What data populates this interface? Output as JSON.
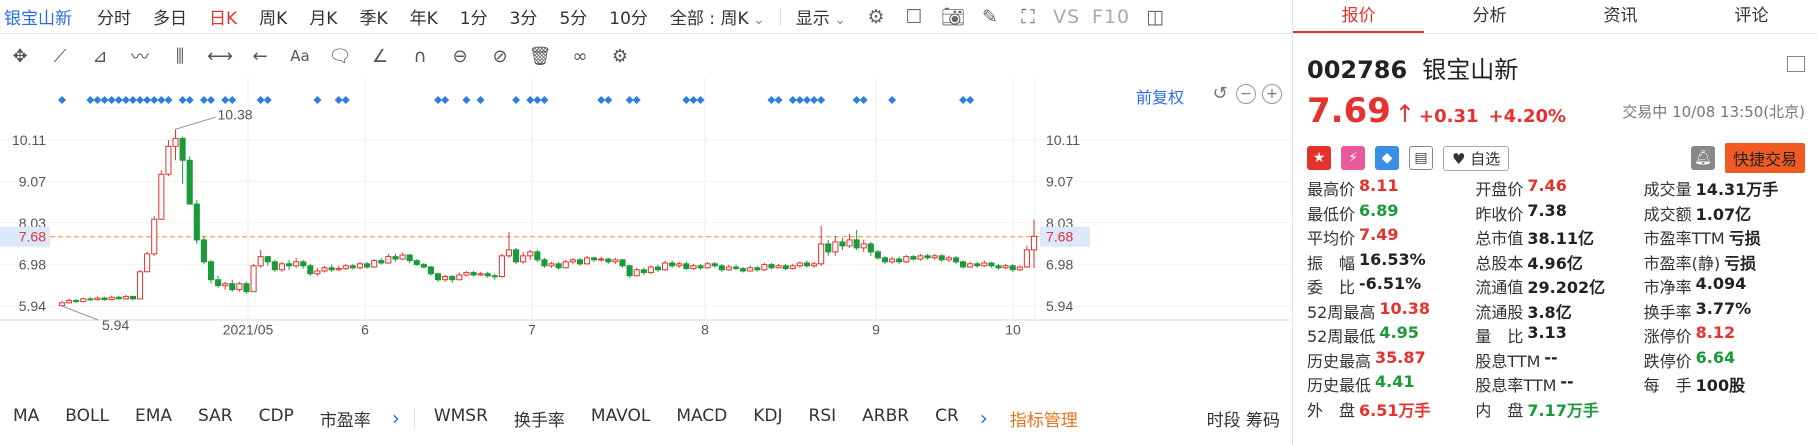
{
  "period_bar": {
    "stock_name": "银宝山新",
    "periods": [
      "分时",
      "多日",
      "日K",
      "周K",
      "月K",
      "季K",
      "年K",
      "1分",
      "3分",
      "5分",
      "10分"
    ],
    "active_period": "日K",
    "range_select": "全部 : 周K",
    "display_label": "显示",
    "vs_label": "VS",
    "f10_label": "F10"
  },
  "chart_header": {
    "fuquan_label": "前复权"
  },
  "chart_data": {
    "type": "candlestick",
    "y_ticks": [
      10.11,
      9.07,
      8.03,
      6.98,
      5.94
    ],
    "y_tick_labels": [
      "10.11",
      "9.07",
      "8.03",
      "6.98",
      "5.94"
    ],
    "x_labels": [
      "2021/05",
      "6",
      "7",
      "8",
      "9",
      "10"
    ],
    "ylim": [
      5.3,
      10.7
    ],
    "current_price_line": 7.68,
    "current_price_label": "7.68",
    "high_marker": "10.38",
    "low_marker": "5.94",
    "colors": {
      "up": "#e6322e",
      "down": "#1b9a3a",
      "signal": "#2e7de1",
      "price_line": "#f08a2e"
    },
    "candles": [
      [
        5.95,
        6.02,
        6.06,
        5.94
      ],
      [
        6.02,
        6.08,
        6.12,
        6.0
      ],
      [
        6.08,
        6.05,
        6.12,
        6.02
      ],
      [
        6.05,
        6.12,
        6.15,
        6.03
      ],
      [
        6.12,
        6.1,
        6.16,
        6.07
      ],
      [
        6.1,
        6.14,
        6.18,
        6.08
      ],
      [
        6.14,
        6.1,
        6.17,
        6.07
      ],
      [
        6.1,
        6.16,
        6.2,
        6.08
      ],
      [
        6.16,
        6.12,
        6.2,
        6.1
      ],
      [
        6.12,
        6.18,
        6.22,
        6.1
      ],
      [
        6.18,
        6.12,
        6.2,
        6.08
      ],
      [
        6.12,
        6.8,
        6.85,
        6.12
      ],
      [
        6.8,
        7.25,
        7.3,
        6.8
      ],
      [
        7.25,
        8.12,
        8.2,
        7.2
      ],
      [
        8.12,
        9.25,
        9.35,
        8.1
      ],
      [
        9.25,
        9.95,
        10.11,
        9.2
      ],
      [
        9.95,
        10.15,
        10.38,
        9.6
      ],
      [
        10.15,
        9.6,
        10.2,
        9.0
      ],
      [
        9.6,
        8.5,
        9.7,
        8.5
      ],
      [
        8.5,
        7.6,
        8.6,
        7.5
      ],
      [
        7.6,
        7.05,
        7.7,
        7.0
      ],
      [
        7.05,
        6.6,
        7.1,
        6.5
      ],
      [
        6.6,
        6.45,
        6.7,
        6.4
      ],
      [
        6.45,
        6.5,
        6.55,
        6.35
      ],
      [
        6.5,
        6.35,
        6.6,
        6.3
      ],
      [
        6.35,
        6.5,
        6.55,
        6.3
      ],
      [
        6.5,
        6.3,
        6.55,
        6.25
      ],
      [
        6.3,
        6.95,
        7.0,
        6.3
      ],
      [
        6.95,
        7.18,
        7.35,
        6.9
      ],
      [
        7.18,
        7.05,
        7.2,
        6.95
      ],
      [
        7.05,
        6.85,
        7.1,
        6.8
      ],
      [
        6.85,
        7.0,
        7.05,
        6.8
      ],
      [
        7.0,
        6.95,
        7.1,
        6.85
      ],
      [
        6.95,
        7.05,
        7.15,
        6.9
      ],
      [
        7.05,
        6.95,
        7.1,
        6.88
      ],
      [
        6.95,
        6.75,
        7.0,
        6.7
      ],
      [
        6.75,
        6.82,
        6.9,
        6.7
      ],
      [
        6.82,
        6.9,
        6.95,
        6.78
      ],
      [
        6.9,
        6.85,
        6.98,
        6.8
      ],
      [
        6.85,
        6.88,
        6.95,
        6.82
      ],
      [
        6.88,
        6.95,
        7.0,
        6.85
      ],
      [
        6.95,
        6.9,
        7.0,
        6.85
      ],
      [
        6.9,
        7.0,
        7.05,
        6.86
      ],
      [
        7.0,
        6.92,
        7.05,
        6.88
      ],
      [
        6.92,
        7.08,
        7.12,
        6.9
      ],
      [
        7.08,
        7.02,
        7.15,
        6.98
      ],
      [
        7.02,
        7.18,
        7.25,
        7.0
      ],
      [
        7.18,
        7.12,
        7.25,
        7.05
      ],
      [
        7.12,
        7.22,
        7.28,
        7.1
      ],
      [
        7.22,
        7.08,
        7.25,
        7.02
      ],
      [
        7.08,
        6.98,
        7.12,
        6.95
      ],
      [
        6.98,
        6.92,
        7.02,
        6.88
      ],
      [
        6.92,
        6.75,
        6.95,
        6.7
      ],
      [
        6.75,
        6.6,
        6.78,
        6.55
      ],
      [
        6.6,
        6.68,
        6.72,
        6.55
      ],
      [
        6.68,
        6.6,
        6.72,
        6.52
      ],
      [
        6.6,
        6.72,
        6.78,
        6.58
      ],
      [
        6.72,
        6.78,
        6.82,
        6.68
      ],
      [
        6.78,
        6.72,
        6.82,
        6.68
      ],
      [
        6.72,
        6.75,
        6.8,
        6.7
      ],
      [
        6.75,
        6.7,
        6.8,
        6.65
      ],
      [
        6.7,
        6.68,
        6.75,
        6.6
      ],
      [
        6.68,
        7.2,
        7.25,
        6.65
      ],
      [
        7.2,
        7.35,
        7.8,
        7.15
      ],
      [
        7.35,
        7.05,
        7.4,
        7.0
      ],
      [
        7.05,
        7.2,
        7.3,
        7.0
      ],
      [
        7.2,
        7.3,
        7.35,
        7.1
      ],
      [
        7.3,
        7.1,
        7.35,
        7.05
      ],
      [
        7.1,
        6.95,
        7.15,
        6.9
      ],
      [
        6.95,
        7.0,
        7.05,
        6.9
      ],
      [
        7.0,
        6.9,
        7.05,
        6.85
      ],
      [
        6.9,
        7.05,
        7.1,
        6.88
      ],
      [
        7.05,
        7.1,
        7.15,
        7.0
      ],
      [
        7.1,
        7.0,
        7.15,
        6.95
      ],
      [
        7.0,
        7.15,
        7.2,
        6.98
      ],
      [
        7.15,
        7.1,
        7.18,
        7.05
      ],
      [
        7.1,
        7.12,
        7.18,
        7.05
      ],
      [
        7.12,
        7.05,
        7.15,
        7.0
      ],
      [
        7.05,
        7.1,
        7.15,
        7.0
      ],
      [
        7.1,
        6.95,
        7.12,
        6.9
      ],
      [
        6.95,
        6.7,
        6.98,
        6.65
      ],
      [
        6.7,
        6.85,
        6.9,
        6.68
      ],
      [
        6.85,
        6.78,
        6.9,
        6.72
      ],
      [
        6.78,
        6.92,
        6.96,
        6.75
      ],
      [
        6.92,
        6.85,
        6.98,
        6.8
      ],
      [
        6.85,
        7.02,
        7.08,
        6.82
      ],
      [
        7.02,
        6.95,
        7.08,
        6.9
      ],
      [
        6.95,
        7.0,
        7.05,
        6.9
      ],
      [
        7.0,
        6.88,
        7.05,
        6.85
      ],
      [
        6.88,
        6.95,
        7.0,
        6.85
      ],
      [
        6.95,
        6.9,
        7.0,
        6.85
      ],
      [
        6.9,
        7.0,
        7.05,
        6.88
      ],
      [
        7.0,
        6.95,
        7.05,
        6.9
      ],
      [
        6.95,
        6.85,
        7.0,
        6.8
      ],
      [
        6.85,
        6.92,
        6.98,
        6.82
      ],
      [
        6.92,
        6.88,
        6.98,
        6.84
      ],
      [
        6.88,
        6.82,
        6.92,
        6.78
      ],
      [
        6.82,
        6.9,
        6.96,
        6.8
      ],
      [
        6.9,
        6.85,
        6.95,
        6.8
      ],
      [
        6.85,
        6.98,
        7.02,
        6.82
      ],
      [
        6.98,
        6.9,
        7.02,
        6.86
      ],
      [
        6.9,
        6.95,
        7.0,
        6.88
      ],
      [
        6.95,
        6.88,
        7.0,
        6.84
      ],
      [
        6.88,
        6.95,
        7.0,
        6.85
      ],
      [
        6.95,
        7.02,
        7.06,
        6.9
      ],
      [
        7.02,
        6.95,
        7.08,
        6.9
      ],
      [
        6.95,
        7.0,
        7.05,
        6.9
      ],
      [
        7.0,
        7.5,
        7.95,
        6.95
      ],
      [
        7.5,
        7.3,
        7.6,
        7.2
      ],
      [
        7.3,
        7.55,
        7.7,
        7.2
      ],
      [
        7.55,
        7.45,
        7.65,
        7.35
      ],
      [
        7.45,
        7.6,
        7.75,
        7.4
      ],
      [
        7.6,
        7.4,
        7.85,
        7.35
      ],
      [
        7.4,
        7.5,
        7.6,
        7.3
      ],
      [
        7.5,
        7.3,
        7.55,
        7.2
      ],
      [
        7.3,
        7.15,
        7.35,
        7.1
      ],
      [
        7.15,
        7.05,
        7.2,
        7.0
      ],
      [
        7.05,
        7.12,
        7.18,
        7.0
      ],
      [
        7.12,
        7.05,
        7.18,
        7.0
      ],
      [
        7.05,
        7.18,
        7.22,
        7.02
      ],
      [
        7.18,
        7.12,
        7.22,
        7.08
      ],
      [
        7.12,
        7.2,
        7.25,
        7.08
      ],
      [
        7.2,
        7.15,
        7.25,
        7.1
      ],
      [
        7.15,
        7.2,
        7.25,
        7.1
      ],
      [
        7.2,
        7.1,
        7.25,
        7.05
      ],
      [
        7.1,
        7.15,
        7.2,
        7.05
      ],
      [
        7.15,
        7.05,
        7.2,
        7.0
      ],
      [
        7.05,
        6.92,
        7.08,
        6.88
      ],
      [
        6.92,
        7.0,
        7.05,
        6.9
      ],
      [
        7.0,
        6.95,
        7.05,
        6.9
      ],
      [
        6.95,
        7.02,
        7.08,
        6.92
      ],
      [
        7.02,
        6.95,
        7.05,
        6.9
      ],
      [
        6.95,
        6.9,
        7.0,
        6.85
      ],
      [
        6.9,
        6.95,
        7.0,
        6.86
      ],
      [
        6.95,
        6.85,
        7.0,
        6.8
      ],
      [
        6.85,
        6.92,
        6.96,
        6.82
      ],
      [
        6.92,
        7.35,
        7.45,
        6.9
      ],
      [
        7.35,
        7.69,
        8.11,
        6.89
      ]
    ],
    "signal_markers": [
      0,
      4,
      5,
      6,
      7,
      8,
      9,
      10,
      11,
      12,
      13,
      14,
      15,
      17,
      18,
      20,
      21,
      23,
      24,
      28,
      29,
      36,
      39,
      40,
      53,
      54,
      57,
      59,
      64,
      66,
      67,
      68,
      76,
      77,
      80,
      81,
      88,
      89,
      90,
      100,
      101,
      103,
      104,
      105,
      106,
      107,
      112,
      113,
      117,
      127,
      128
    ]
  },
  "indicator_bar": {
    "items_left": [
      "MA",
      "BOLL",
      "EMA",
      "SAR",
      "CDP",
      "市盈率"
    ],
    "items_right": [
      "WMSR",
      "换手率",
      "MAVOL",
      "MACD",
      "KDJ",
      "RSI",
      "ARBR",
      "CR"
    ],
    "manage_label": "指标管理",
    "right_label": "时段 筹码"
  },
  "right_panel": {
    "tabs": [
      "报价",
      "分析",
      "资讯",
      "评论"
    ],
    "active_tab": "报价",
    "code": "002786",
    "name": "银宝山新",
    "price": "7.69",
    "change": "+0.31",
    "change_pct": "+4.20%",
    "trade_time": "交易中 10/08 13:50(北京)",
    "zixuan_label": "自选",
    "trade_button": "快捷交易",
    "stats": [
      [
        {
          "label": "最高价",
          "value": "8.11",
          "color": "red"
        },
        {
          "label": "开盘价",
          "value": "7.46",
          "color": "red"
        },
        {
          "label": "成交量",
          "value": "14.31万手",
          "color": "dark"
        }
      ],
      [
        {
          "label": "最低价",
          "value": "6.89",
          "color": "green"
        },
        {
          "label": "昨收价",
          "value": "7.38",
          "color": "dark"
        },
        {
          "label": "成交额",
          "value": "1.07亿",
          "color": "dark"
        }
      ],
      [
        {
          "label": "平均价",
          "value": "7.49",
          "color": "red"
        },
        {
          "label": "总市值",
          "value": "38.11亿",
          "color": "dark"
        },
        {
          "label": "市盈率TTM",
          "value": "亏损",
          "color": "dark"
        }
      ],
      [
        {
          "label": "振　幅",
          "value": "16.53%",
          "color": "dark"
        },
        {
          "label": "总股本",
          "value": "4.96亿",
          "color": "dark"
        },
        {
          "label": "市盈率(静)",
          "value": "亏损",
          "color": "dark"
        }
      ],
      [
        {
          "label": "委　比",
          "value": "-6.51%",
          "color": "dark"
        },
        {
          "label": "流通值",
          "value": "29.202亿",
          "color": "dark"
        },
        {
          "label": "市净率",
          "value": "4.094",
          "color": "dark"
        }
      ],
      [
        {
          "label": "52周最高",
          "value": "10.38",
          "color": "red"
        },
        {
          "label": "流通股",
          "value": "3.8亿",
          "color": "dark"
        },
        {
          "label": "换手率",
          "value": "3.77%",
          "color": "dark"
        }
      ],
      [
        {
          "label": "52周最低",
          "value": "4.95",
          "color": "green"
        },
        {
          "label": "量　比",
          "value": "3.13",
          "color": "dark"
        },
        {
          "label": "涨停价",
          "value": "8.12",
          "color": "red"
        }
      ],
      [
        {
          "label": "历史最高",
          "value": "35.87",
          "color": "red"
        },
        {
          "label": "股息TTM",
          "value": "--",
          "color": "dark"
        },
        {
          "label": "跌停价",
          "value": "6.64",
          "color": "green"
        }
      ],
      [
        {
          "label": "历史最低",
          "value": "4.41",
          "color": "green"
        },
        {
          "label": "股息率TTM",
          "value": "--",
          "color": "dark"
        },
        {
          "label": "每　手",
          "value": "100股",
          "color": "dark"
        }
      ],
      [
        {
          "label": "外　盘",
          "value": "6.51万手",
          "color": "red"
        },
        {
          "label": "内　盘",
          "value": "7.17万手",
          "color": "green"
        },
        {
          "label": "",
          "value": "",
          "color": "dark"
        }
      ]
    ]
  }
}
